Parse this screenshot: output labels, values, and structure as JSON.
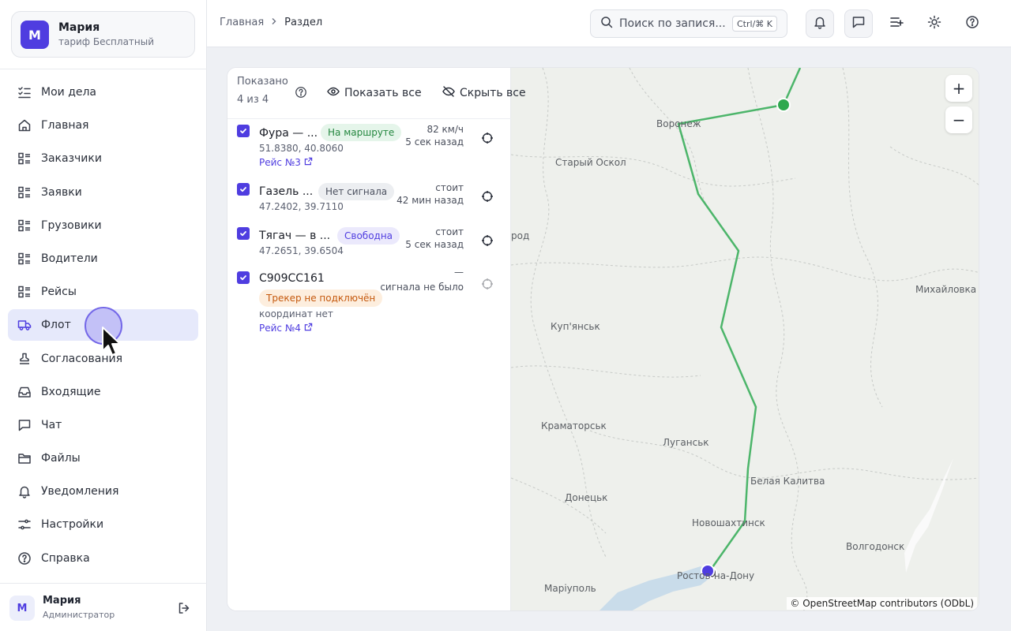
{
  "account": {
    "initial": "М",
    "name": "Мария",
    "plan": "тариф Бесплатный"
  },
  "nav": {
    "items": [
      {
        "label": "Мои дела",
        "icon": "checklist-icon"
      },
      {
        "label": "Главная",
        "icon": "home-icon"
      },
      {
        "label": "Заказчики",
        "icon": "list-icon"
      },
      {
        "label": "Заявки",
        "icon": "list-icon"
      },
      {
        "label": "Грузовики",
        "icon": "list-icon"
      },
      {
        "label": "Водители",
        "icon": "list-icon"
      },
      {
        "label": "Рейсы",
        "icon": "list-icon"
      },
      {
        "label": "Флот",
        "icon": "truck-icon",
        "active": true
      },
      {
        "label": "Согласования",
        "icon": "stamp-icon"
      },
      {
        "label": "Входящие",
        "icon": "inbox-icon"
      },
      {
        "label": "Чат",
        "icon": "chat-icon"
      },
      {
        "label": "Файлы",
        "icon": "folder-icon"
      },
      {
        "label": "Уведомления",
        "icon": "bell-icon"
      },
      {
        "label": "Настройки",
        "icon": "sliders-icon"
      },
      {
        "label": "Справка",
        "icon": "help-icon"
      }
    ]
  },
  "user": {
    "initial": "М",
    "name": "Мария",
    "role": "Администратор"
  },
  "breadcrumb": {
    "home": "Главная",
    "separator": ">",
    "current": "Раздел"
  },
  "search": {
    "placeholder": "Поиск по запися...",
    "shortcut": "Ctrl/⌘ K"
  },
  "fleet": {
    "shown_label": "Показано",
    "shown_count": "4 из 4",
    "show_all": "Показать все",
    "hide_all": "Скрыть все",
    "vehicles": [
      {
        "name": "Фура — ...",
        "status": "На маршруте",
        "status_color": "green",
        "coords": "51.8380, 40.8060",
        "trip": "Рейс №3",
        "meta1": "82 км/ч",
        "meta2": "5 сек назад"
      },
      {
        "name": "Газель ...",
        "status": "Нет сигнала",
        "status_color": "gray",
        "coords": "47.2402, 39.7110",
        "trip": "",
        "meta1": "стоит",
        "meta2": "42 мин назад"
      },
      {
        "name": "Тягач — в ...",
        "status": "Свободна",
        "status_color": "purple",
        "coords": "47.2651, 39.6504",
        "trip": "",
        "meta1": "стоит",
        "meta2": "5 сек назад"
      },
      {
        "name": "С909СС161",
        "status": "Трекер не подключён",
        "status_color": "orange",
        "coords": "координат нет",
        "trip": "Рейс №4",
        "meta1": "—",
        "meta2": "сигнала не было"
      }
    ]
  },
  "map": {
    "zoom_in": "+",
    "zoom_out": "−",
    "attribution": "© OpenStreetMap contributors (ODbL)",
    "cities": [
      "Воронеж",
      "Старый Оскол",
      "род",
      "Михайловка",
      "Куп'янськ",
      "Краматорськ",
      "Луганськ",
      "Белая Калитва",
      "Донецьк",
      "Новошахтинск",
      "Волгодонск",
      "Ростов-на-Дону",
      "Маріуполь"
    ],
    "route_color": "#4cb56a",
    "accent": "#4f3de0"
  }
}
